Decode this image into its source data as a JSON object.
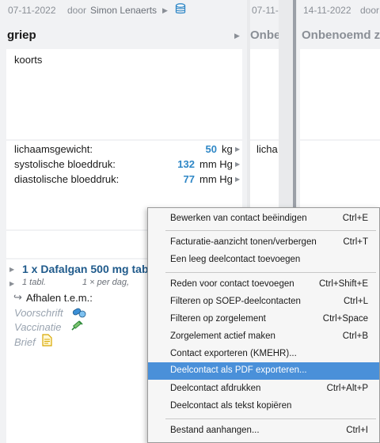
{
  "columns": [
    {
      "date": "07-11-2022",
      "door": "door",
      "author": "Simon Lenaerts",
      "title": "griep",
      "complaint": "koorts",
      "vitals": [
        {
          "label": "lichaamsgewicht:",
          "value": "50",
          "unit": "kg"
        },
        {
          "label": "systolische bloeddruk:",
          "value": "132",
          "unit": "mm Hg"
        },
        {
          "label": "diastolische bloeddruk:",
          "value": "77",
          "unit": "mm Hg"
        }
      ],
      "medication": {
        "title": "1 x Dafalgan 500 mg tab",
        "dose": "1 tabl.",
        "freq": "1 × per dag,",
        "extra": "Afhalen t.e.m.:"
      },
      "docs": [
        "Voorschrift",
        "Vaccinatie",
        "Brief"
      ]
    },
    {
      "date": "07-11-",
      "title": "Onbe",
      "vital_label": "licha"
    },
    {
      "date": "14-11-2022",
      "door": "door",
      "title": "Onbenoemd ze"
    }
  ],
  "context_menu": {
    "items": [
      {
        "label": "Bewerken van contact beëindigen",
        "shortcut": "Ctrl+E"
      },
      {
        "label": "Facturatie-aanzicht tonen/verbergen",
        "shortcut": "Ctrl+T"
      },
      {
        "label": "Een leeg deelcontact toevoegen",
        "shortcut": ""
      },
      {
        "label": "Reden voor contact toevoegen",
        "shortcut": "Ctrl+Shift+E"
      },
      {
        "label": "Filteren op SOEP-deelcontacten",
        "shortcut": "Ctrl+L"
      },
      {
        "label": "Filteren op zorgelement",
        "shortcut": "Ctrl+Space"
      },
      {
        "label": "Zorgelement actief maken",
        "shortcut": "Ctrl+B"
      },
      {
        "label": "Contact exporteren (KMEHR)...",
        "shortcut": ""
      },
      {
        "label": "Deelcontact als PDF exporteren...",
        "shortcut": ""
      },
      {
        "label": "Deelcontact afdrukken",
        "shortcut": "Ctrl+Alt+P"
      },
      {
        "label": "Deelcontact als tekst kopiëren",
        "shortcut": ""
      },
      {
        "label": "Bestand aanhangen...",
        "shortcut": "Ctrl+I"
      }
    ],
    "selected": "Deelcontact als PDF exporteren..."
  },
  "icons": {
    "database": "database-icon",
    "pills": "pills-icon",
    "syringe": "syringe-icon",
    "document": "document-icon",
    "expand": "triangle-right-icon"
  },
  "colors": {
    "accent": "#2f87c6",
    "medication": "#1f5a8b",
    "menu_highlight": "#4a90d9"
  }
}
